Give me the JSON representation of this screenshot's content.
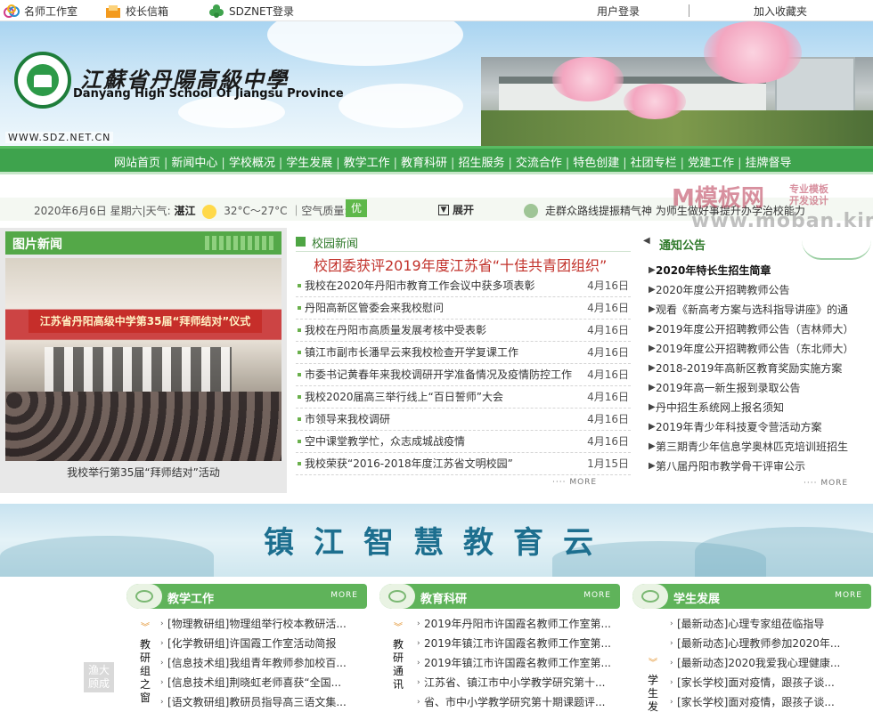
{
  "topbar": {
    "links": [
      "名师工作室",
      "校长信箱",
      "SDZNET登录"
    ],
    "user_login": "用户登录",
    "add_favorite": "加入收藏夹"
  },
  "banner": {
    "school_name_cn": "江蘇省丹陽高級中學",
    "school_name_en": "Danyang High School Of Jiangsu Province",
    "domain": "WWW.SDZ.NET.CN"
  },
  "nav": {
    "items": [
      "网站首页",
      "新闻中心",
      "学校概况",
      "学生发展",
      "教学工作",
      "教育科研",
      "招生服务",
      "交流合作",
      "特色创建",
      "社团专栏",
      "党建工作",
      "挂牌督导"
    ]
  },
  "infobar": {
    "date": "2020年6月6日 星期六|天气:",
    "city": "湛江",
    "temp": "32°C～27°C ｜空气质量:",
    "air_quality": "优",
    "expand": "展开",
    "marquee": "走群众路线提振精气神  为师生做好事提升办学治校能力"
  },
  "watermark": {
    "brand": "M模板网",
    "tag1": "专业模板",
    "tag2": "开发设计",
    "url": "www.moban.kim"
  },
  "pic_news": {
    "title": "图片新闻",
    "photo_banner": "江苏省丹阳高级中学第35届“拜师结对”仪式",
    "caption": "我校举行第35届“拜师结对”活动"
  },
  "campus_news": {
    "title": "校园新闻",
    "headline": "校团委获评2019年度江苏省“十佳共青团组织”",
    "items": [
      {
        "title": "我校在2020年丹阳市教育工作会议中获多项表彰",
        "date": "4月16日"
      },
      {
        "title": "丹阳高新区管委会来我校慰问",
        "date": "4月16日"
      },
      {
        "title": "我校在丹阳市高质量发展考核中受表彰",
        "date": "4月16日"
      },
      {
        "title": "镇江市副市长潘早云来我校检查开学复课工作",
        "date": "4月16日"
      },
      {
        "title": "市委书记黄春年来我校调研开学准备情况及疫情防控工作",
        "date": "4月16日"
      },
      {
        "title": "我校2020届高三举行线上“百日誓师”大会",
        "date": "4月16日"
      },
      {
        "title": "市领导来我校调研",
        "date": "4月16日"
      },
      {
        "title": "空中课堂教学忙，众志成城战疫情",
        "date": "4月16日"
      },
      {
        "title": "我校荣获“2016-2018年度江苏省文明校园”",
        "date": "1月15日"
      }
    ],
    "more": "MORE"
  },
  "notice": {
    "title": "通知公告",
    "items": [
      "2020年特长生招生简章",
      "2020年度公开招聘教师公告",
      "观看《新高考方案与选科指导讲座》的通",
      "2019年度公开招聘教师公告（吉林师大）",
      "2019年度公开招聘教师公告（东北师大）",
      "2018-2019年高新区教育奖励实施方案",
      "2019年高一新生报到录取公告",
      "丹中招生系统网上报名须知",
      "2019年青少年科技夏令营活动方案",
      "第三期青少年信息学奥林匹克培训班招生",
      "第八届丹阳市教学骨干评审公示"
    ],
    "more": "MORE"
  },
  "cloud_banner": {
    "title": "镇江智慧教育云"
  },
  "teaching": {
    "title": "教学工作",
    "more": "MORE",
    "side_label": "教研组之窗",
    "stamp": "渔大顾成",
    "items": [
      "[物理教研组]物理组举行校本教研活...",
      "[化学教研组]许国霞工作室活动简报",
      "[信息技术组]我组青年教师参加校百...",
      "[信息技术组]荆晓虹老师喜获“全国...",
      "[语文教研组]教研员指导高三语文集..."
    ]
  },
  "research": {
    "title": "教育科研",
    "more": "MORE",
    "side_label": "教研通讯",
    "items": [
      "2019年丹阳市许国霞名教师工作室第...",
      "2019年镇江市许国霞名教师工作室第...",
      "2019年镇江市许国霞名教师工作室第...",
      "江苏省、镇江市中小学教学研究第十...",
      "省、市中小学教学研究第十期课题评..."
    ]
  },
  "student": {
    "title": "学生发展",
    "more": "MORE",
    "side_label": "学生发展",
    "items": [
      "[最新动态]心理专家组莅临指导",
      "[最新动态]心理教师参加2020年...",
      "[最新动态]2020我爱我心理健康...",
      "[家长学校]面对疫情，跟孩子谈...",
      "[家长学校]面对疫情，跟孩子谈..."
    ]
  }
}
